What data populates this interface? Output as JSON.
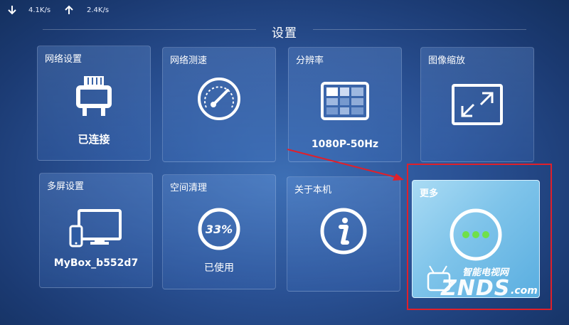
{
  "status": {
    "download": "4.1K/s",
    "upload": "2.4K/s"
  },
  "page_title": "设置",
  "tiles": [
    {
      "label": "网络设置",
      "value": "已连接",
      "icon": "ethernet-icon"
    },
    {
      "label": "网络测速",
      "value": "",
      "icon": "speedometer-icon"
    },
    {
      "label": "分辨率",
      "value": "1080P-50Hz",
      "icon": "resolution-grid-icon"
    },
    {
      "label": "图像缩放",
      "value": "",
      "icon": "expand-icon"
    },
    {
      "label": "多屏设置",
      "value": "MyBox_b552d7",
      "icon": "multiscreen-icon"
    },
    {
      "label": "空间清理",
      "value": "已使用",
      "icon": "storage-ring-icon",
      "percent": "33%"
    },
    {
      "label": "关于本机",
      "value": "",
      "icon": "info-icon"
    },
    {
      "label": "更多",
      "value": "",
      "icon": "more-dots-icon",
      "selected": true
    }
  ],
  "watermark": {
    "line1": "智能电视网",
    "line2": "ZNDS",
    "line3": ".com"
  },
  "colors": {
    "highlight": "#e0202a",
    "selected_tile": "#7fc4ea",
    "dots": "#6fe04a"
  }
}
